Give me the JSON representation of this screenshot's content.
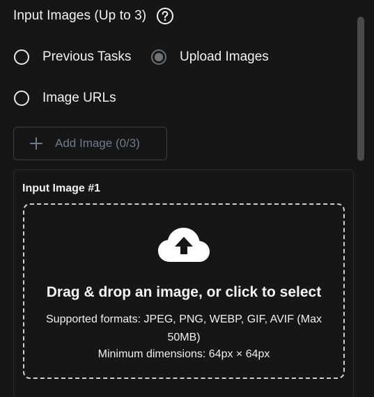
{
  "header": {
    "title": "Input Images (Up to 3)",
    "help_icon": "question-circle-icon"
  },
  "source_options": [
    {
      "label": "Previous Tasks",
      "selected": false
    },
    {
      "label": "Upload Images",
      "selected": true
    },
    {
      "label": "Image URLs",
      "selected": false
    }
  ],
  "add_button": {
    "label": "Add Image (0/3)",
    "icon": "plus-icon",
    "enabled": false
  },
  "image_card": {
    "title": "Input Image #1",
    "dropzone": {
      "icon": "cloud-upload-icon",
      "main_text": "Drag & drop an image, or click to select",
      "formats_text": "Supported formats: JPEG, PNG, WEBP, GIF, AVIF (Max 50MB)",
      "min_dimensions_text": "Minimum dimensions: 64px × 64px"
    }
  },
  "colors": {
    "background": "#161616",
    "text": "#f2f2f2",
    "muted": "#6f7b8a",
    "radio_selected": "#6f737a",
    "border": "#3a3d41"
  }
}
